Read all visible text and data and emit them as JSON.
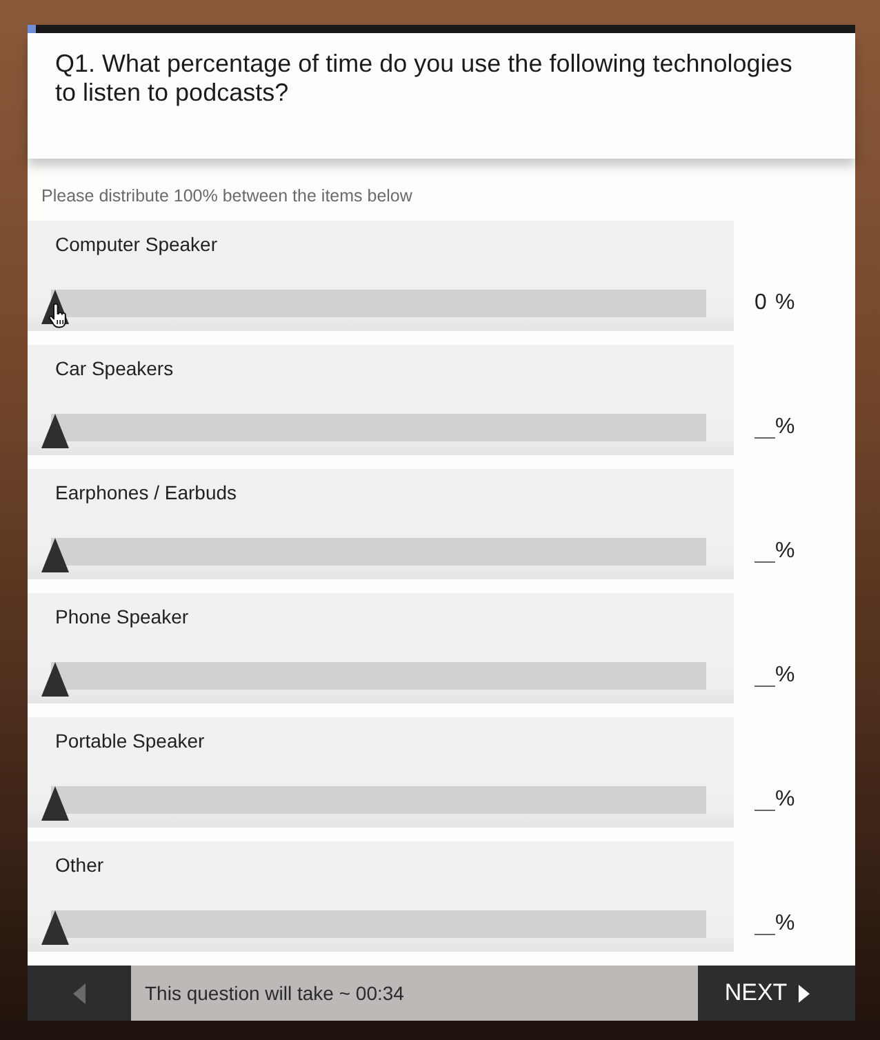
{
  "progress": {
    "level": 0.01
  },
  "question": {
    "text": "Q1. What percentage of time do you use the following technologies to listen to podcasts?"
  },
  "instruction": "Please distribute 100% between the items below",
  "items": [
    {
      "label": "Computer Speaker",
      "level": 0,
      "value": "0",
      "unit": "%",
      "hovered": true
    },
    {
      "label": "Car Speakers",
      "level": 0,
      "unit": "%",
      "hovered": false
    },
    {
      "label": "Earphones / Earbuds",
      "level": 0,
      "unit": "%",
      "hovered": false
    },
    {
      "label": "Phone Speaker",
      "level": 0,
      "unit": "%",
      "hovered": false
    },
    {
      "label": "Portable Speaker",
      "level": 0,
      "unit": "%",
      "hovered": false
    },
    {
      "label": "Other",
      "level": 0,
      "unit": "%",
      "hovered": false
    }
  ],
  "footer": {
    "back": {
      "disabled": true
    },
    "time_estimate": "This question will take ~ 00:34",
    "next": {
      "label": "NEXT"
    }
  }
}
